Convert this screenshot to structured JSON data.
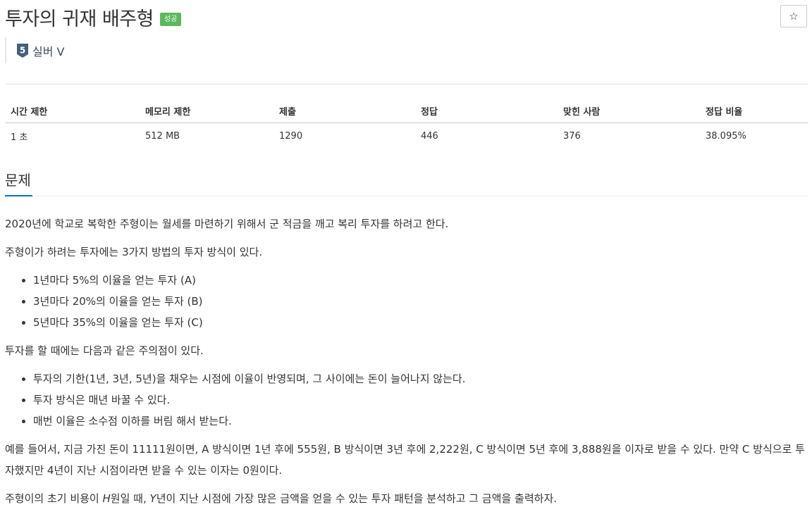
{
  "problem": {
    "title": "투자의 귀재 배주형",
    "result_badge": "성공",
    "star_icon": "☆",
    "tier_number": "5",
    "tier_label": "실버 V"
  },
  "info_table": {
    "headers": [
      "시간 제한",
      "메모리 제한",
      "제출",
      "정답",
      "맞힌 사람",
      "정답 비율"
    ],
    "values": [
      "1 초",
      "512 MB",
      "1290",
      "446",
      "376",
      "38.095%"
    ]
  },
  "section": {
    "title": "문제"
  },
  "statement": {
    "p1": "2020년에 학교로 복학한 주형이는 월세를 마련하기 위해서 군 적금을 깨고 복리 투자를 하려고 한다.",
    "p2": "주형이가 하려는 투자에는 3가지 방법의 투자 방식이 있다.",
    "list1": [
      "1년마다 5%의 이율을 얻는 투자 (A)",
      "3년마다 20%의 이율을 얻는 투자 (B)",
      "5년마다 35%의 이율을 얻는 투자 (C)"
    ],
    "p3": "투자를 할 때에는 다음과 같은 주의점이 있다.",
    "list2": [
      "투자의 기한(1년, 3년, 5년)을 채우는 시점에 이율이 반영되며, 그 사이에는 돈이 늘어나지 않는다.",
      "투자 방식은 매년 바꿀 수 있다.",
      "매번 이율은 소수점 이하를 버림 해서 받는다."
    ],
    "p4": "예를 들어서, 지금 가진 돈이 11111원이면, A 방식이면 1년 후에 555원, B 방식이면 3년 후에 2,222원, C 방식이면 5년 후에 3,888원을 이자로 받을 수 있다. 만약 C 방식으로 투자했지만 4년이 지난 시점이라면 받을 수 있는 이자는 0원이다.",
    "p5_a": "주형이의 초기 비용이 ",
    "p5_var_h": "H",
    "p5_b": "원일 때, ",
    "p5_var_y": "Y",
    "p5_c": "년이 지난 시점에 가장 많은 금액을 얻을 수 있는 투자 패턴을 분석하고 그 금액을 출력하자."
  },
  "colors": {
    "badge_success": "#5cb85c",
    "section_underline": "#0076c0",
    "tier_silver": "#435f7a"
  }
}
